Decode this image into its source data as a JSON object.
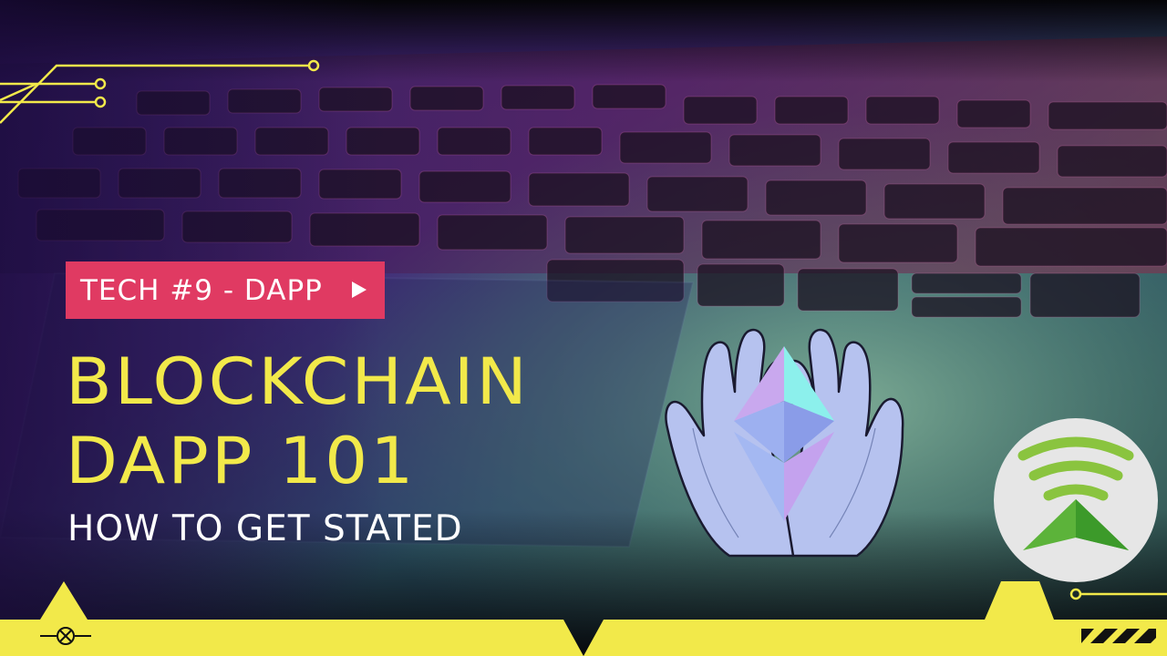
{
  "badge": {
    "label": "TECH #9 - DAPP"
  },
  "title": {
    "line1": "BLOCKCHAIN",
    "line2": "DAPP 101"
  },
  "subtitle": "HOW TO GET STATED",
  "colors": {
    "accent_yellow": "#f2e94a",
    "badge_pink": "#e03a62",
    "logo_green": "#8ac43f"
  },
  "icons": [
    "ethereum-diamond-icon",
    "hands-icon",
    "signal-logo-icon",
    "play-arrow-icon",
    "circuit-line-icon",
    "cross-circle-icon"
  ]
}
